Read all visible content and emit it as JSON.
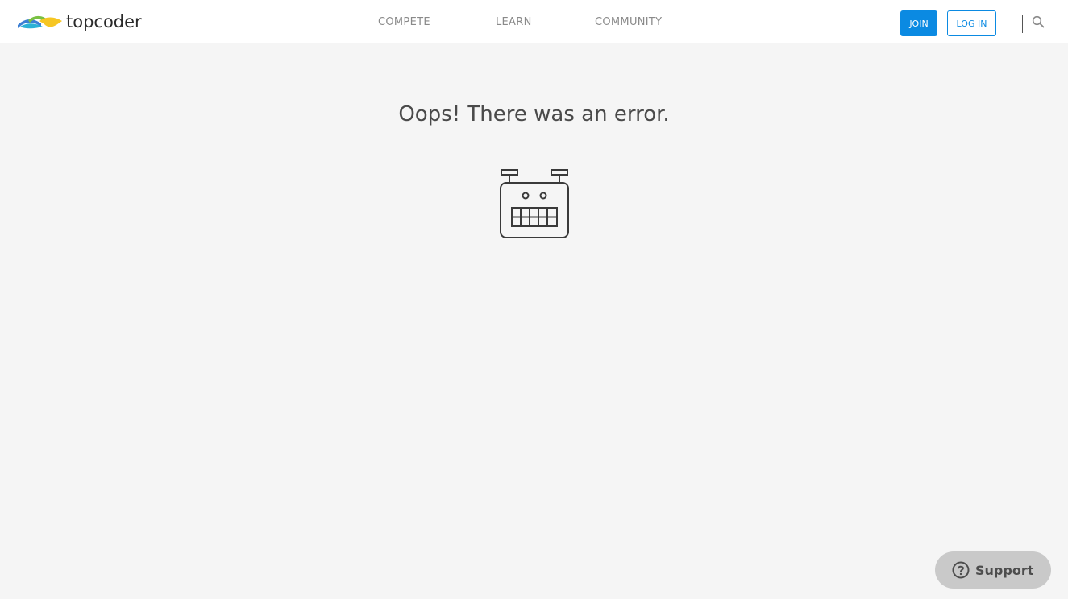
{
  "brand": {
    "name": "topcoder",
    "logo_colors": [
      "#3b7fd4",
      "#2ab1d6",
      "#f6c623",
      "#7ac143"
    ]
  },
  "nav": {
    "items": [
      {
        "label": "COMPETE"
      },
      {
        "label": "LEARN"
      },
      {
        "label": "COMMUNITY"
      }
    ]
  },
  "auth": {
    "join_label": "JOIN",
    "login_label": "LOG IN"
  },
  "icons": {
    "search": "search-icon",
    "error_illustration": "robot-icon",
    "support": "question-circle-icon"
  },
  "main": {
    "error_title": "Oops! There was an error."
  },
  "support": {
    "label": "Support"
  },
  "colors": {
    "accent": "#0b8ae2",
    "background": "#f5f5f5",
    "header_bg": "#ffffff",
    "support_bg": "#c9c9c9"
  }
}
